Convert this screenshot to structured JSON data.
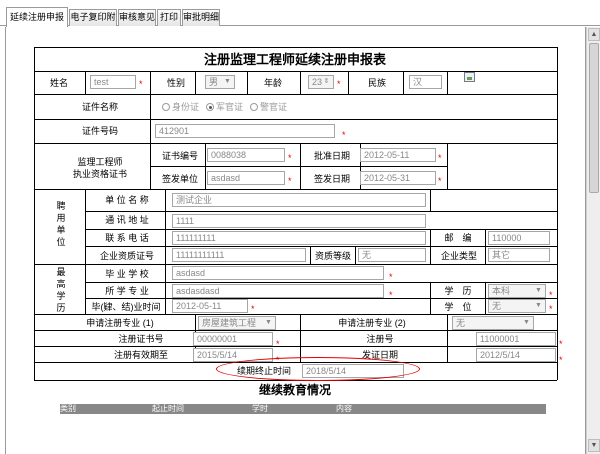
{
  "tabs": [
    {
      "label": "延续注册申报表",
      "active": true
    },
    {
      "label": "电子复印附件",
      "active": false
    },
    {
      "label": "审核意见",
      "active": false
    },
    {
      "label": "打印",
      "active": false
    },
    {
      "label": "审批明细",
      "active": false
    }
  ],
  "form": {
    "title": "注册监理工程师延续注册申报表",
    "labels": {
      "name": "姓名",
      "gender": "性别",
      "age": "年龄",
      "ethnicity": "民族",
      "id_type": "证件名称",
      "id_number": "证件号码",
      "cert_group_line1": "监理工程师",
      "cert_group_line2": "执业资格证书",
      "cert_no": "证书编号",
      "approve_date": "批准日期",
      "issuer": "签发单位",
      "issue_date": "签发日期",
      "employer_group": "聘用单位",
      "unit_name": "单 位 名 称",
      "address": "通 讯 地 址",
      "phone": "联 系 电 话",
      "zip": "邮　编",
      "qual_cert": "企业资质证号",
      "qual_level": "资质等级",
      "company_type": "企业类型",
      "edu_group": "最高学历",
      "school": "毕 业 学 校",
      "major": "所 学 专 业",
      "education": "学　历",
      "grad_date": "毕(肄、结)业时间",
      "degree": "学　位",
      "reg_major1": "申请注册专业 (1)",
      "reg_major2": "申请注册专业 (2)",
      "reg_cert_no": "注册证书号",
      "reg_no": "注册号",
      "reg_valid_until": "注册有效期至",
      "cert_issue_date": "发证日期",
      "renewal_end": "续期终止时间"
    },
    "values": {
      "name": "test",
      "gender": "男",
      "age": "23",
      "ethnicity": "汉",
      "id_number": "412901",
      "cert_no": "0088038",
      "approve_date": "2012-05-11",
      "issuer": "asdasd",
      "issue_date": "2012-05-31",
      "unit_name": "测试企业",
      "address": "1111",
      "phone": "111111111",
      "zip": "110000",
      "qual_cert": "11111111111",
      "qual_level": "无",
      "company_type": "其它",
      "school": "asdasd",
      "major": "asdasdasd",
      "education": "本科",
      "grad_date": "2012-05-11",
      "degree": "无",
      "reg_major1": "房屋建筑工程",
      "reg_major2": "无",
      "reg_cert_no": "00000001",
      "reg_no": "11000001",
      "reg_valid_until": "2015/5/14",
      "cert_issue_date": "2012/5/14",
      "renewal_end": "2018/5/14"
    },
    "id_types": [
      {
        "label": "身份证",
        "selected": false
      },
      {
        "label": "军官证",
        "selected": true
      },
      {
        "label": "警官证",
        "selected": false
      }
    ]
  },
  "education_section": {
    "title": "继续教育情况",
    "columns": [
      "类别",
      "起止时间",
      "学时",
      "内容"
    ]
  },
  "colors": {
    "required_star": "#e60000",
    "highlight_oval": "#e60000",
    "edu_header": "#888888"
  },
  "icons": [
    "photo-icon",
    "scroll-up-icon",
    "scroll-down-icon"
  ]
}
